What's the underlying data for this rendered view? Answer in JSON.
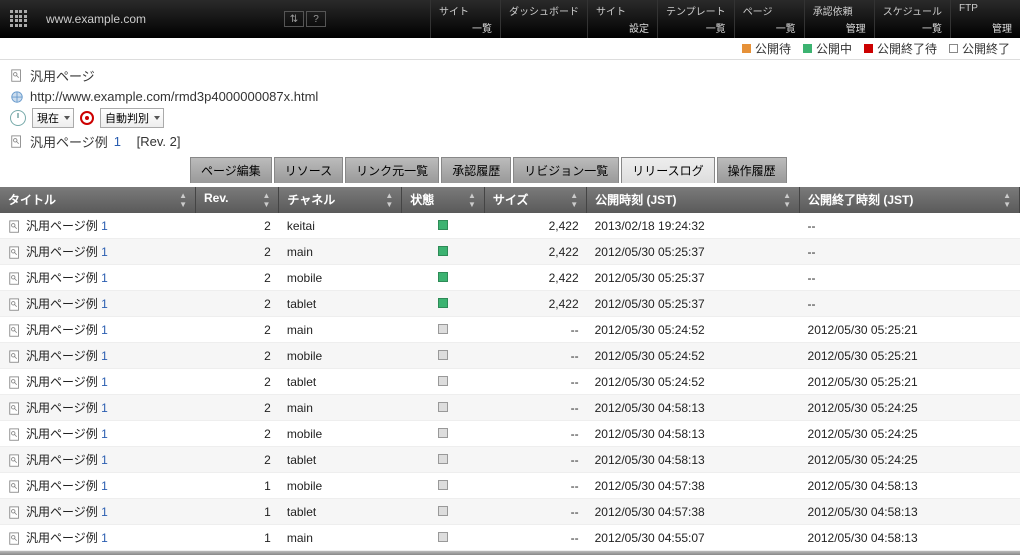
{
  "topbar": {
    "domain": "www.example.com",
    "menus": [
      {
        "title": "サイト",
        "sub": "一覧"
      },
      {
        "title": "ダッシュボード",
        "sub": ""
      },
      {
        "title": "サイト",
        "sub": "設定"
      },
      {
        "title": "テンプレート",
        "sub": "一覧"
      },
      {
        "title": "ページ",
        "sub": "一覧"
      },
      {
        "title": "承認依頼",
        "sub": "管理"
      },
      {
        "title": "スケジュール",
        "sub": "一覧"
      },
      {
        "title": "FTP",
        "sub": "管理"
      }
    ]
  },
  "legend": [
    {
      "color": "orange",
      "label": "公開待"
    },
    {
      "color": "green",
      "label": "公開中"
    },
    {
      "color": "red",
      "label": "公開終了待"
    },
    {
      "color": "white",
      "label": "公開終了"
    }
  ],
  "page": {
    "type_label": "汎用ページ",
    "url": "http://www.example.com/rmd3p4000000087x.html",
    "time_select": "現在",
    "detect_select": "自動判別",
    "title_label": "汎用ページ例",
    "title_num": "1",
    "rev_label": "[Rev. 2]"
  },
  "tabs": [
    {
      "label": "ページ編集",
      "active": false
    },
    {
      "label": "リソース",
      "active": false
    },
    {
      "label": "リンク元一覧",
      "active": false
    },
    {
      "label": "承認履歴",
      "active": false
    },
    {
      "label": "リビジョン一覧",
      "active": false
    },
    {
      "label": "リリースログ",
      "active": true
    },
    {
      "label": "操作履歴",
      "active": false
    }
  ],
  "columns": [
    "タイトル",
    "Rev.",
    "チャネル",
    "状態",
    "サイズ",
    "公開時刻 (JST)",
    "公開終了時刻 (JST)"
  ],
  "rows": [
    {
      "title": "汎用ページ例",
      "num": "1",
      "rev": "2",
      "channel": "keitai",
      "status": "green",
      "size": "2,422",
      "pub": "2013/02/18 19:24:32",
      "end": "--"
    },
    {
      "title": "汎用ページ例",
      "num": "1",
      "rev": "2",
      "channel": "main",
      "status": "green",
      "size": "2,422",
      "pub": "2012/05/30 05:25:37",
      "end": "--"
    },
    {
      "title": "汎用ページ例",
      "num": "1",
      "rev": "2",
      "channel": "mobile",
      "status": "green",
      "size": "2,422",
      "pub": "2012/05/30 05:25:37",
      "end": "--"
    },
    {
      "title": "汎用ページ例",
      "num": "1",
      "rev": "2",
      "channel": "tablet",
      "status": "green",
      "size": "2,422",
      "pub": "2012/05/30 05:25:37",
      "end": "--"
    },
    {
      "title": "汎用ページ例",
      "num": "1",
      "rev": "2",
      "channel": "main",
      "status": "gray",
      "size": "--",
      "pub": "2012/05/30 05:24:52",
      "end": "2012/05/30 05:25:21"
    },
    {
      "title": "汎用ページ例",
      "num": "1",
      "rev": "2",
      "channel": "mobile",
      "status": "gray",
      "size": "--",
      "pub": "2012/05/30 05:24:52",
      "end": "2012/05/30 05:25:21"
    },
    {
      "title": "汎用ページ例",
      "num": "1",
      "rev": "2",
      "channel": "tablet",
      "status": "gray",
      "size": "--",
      "pub": "2012/05/30 05:24:52",
      "end": "2012/05/30 05:25:21"
    },
    {
      "title": "汎用ページ例",
      "num": "1",
      "rev": "2",
      "channel": "main",
      "status": "gray",
      "size": "--",
      "pub": "2012/05/30 04:58:13",
      "end": "2012/05/30 05:24:25"
    },
    {
      "title": "汎用ページ例",
      "num": "1",
      "rev": "2",
      "channel": "mobile",
      "status": "gray",
      "size": "--",
      "pub": "2012/05/30 04:58:13",
      "end": "2012/05/30 05:24:25"
    },
    {
      "title": "汎用ページ例",
      "num": "1",
      "rev": "2",
      "channel": "tablet",
      "status": "gray",
      "size": "--",
      "pub": "2012/05/30 04:58:13",
      "end": "2012/05/30 05:24:25"
    },
    {
      "title": "汎用ページ例",
      "num": "1",
      "rev": "1",
      "channel": "mobile",
      "status": "gray",
      "size": "--",
      "pub": "2012/05/30 04:57:38",
      "end": "2012/05/30 04:58:13"
    },
    {
      "title": "汎用ページ例",
      "num": "1",
      "rev": "1",
      "channel": "tablet",
      "status": "gray",
      "size": "--",
      "pub": "2012/05/30 04:57:38",
      "end": "2012/05/30 04:58:13"
    },
    {
      "title": "汎用ページ例",
      "num": "1",
      "rev": "1",
      "channel": "main",
      "status": "gray",
      "size": "--",
      "pub": "2012/05/30 04:55:07",
      "end": "2012/05/30 04:58:13"
    }
  ]
}
